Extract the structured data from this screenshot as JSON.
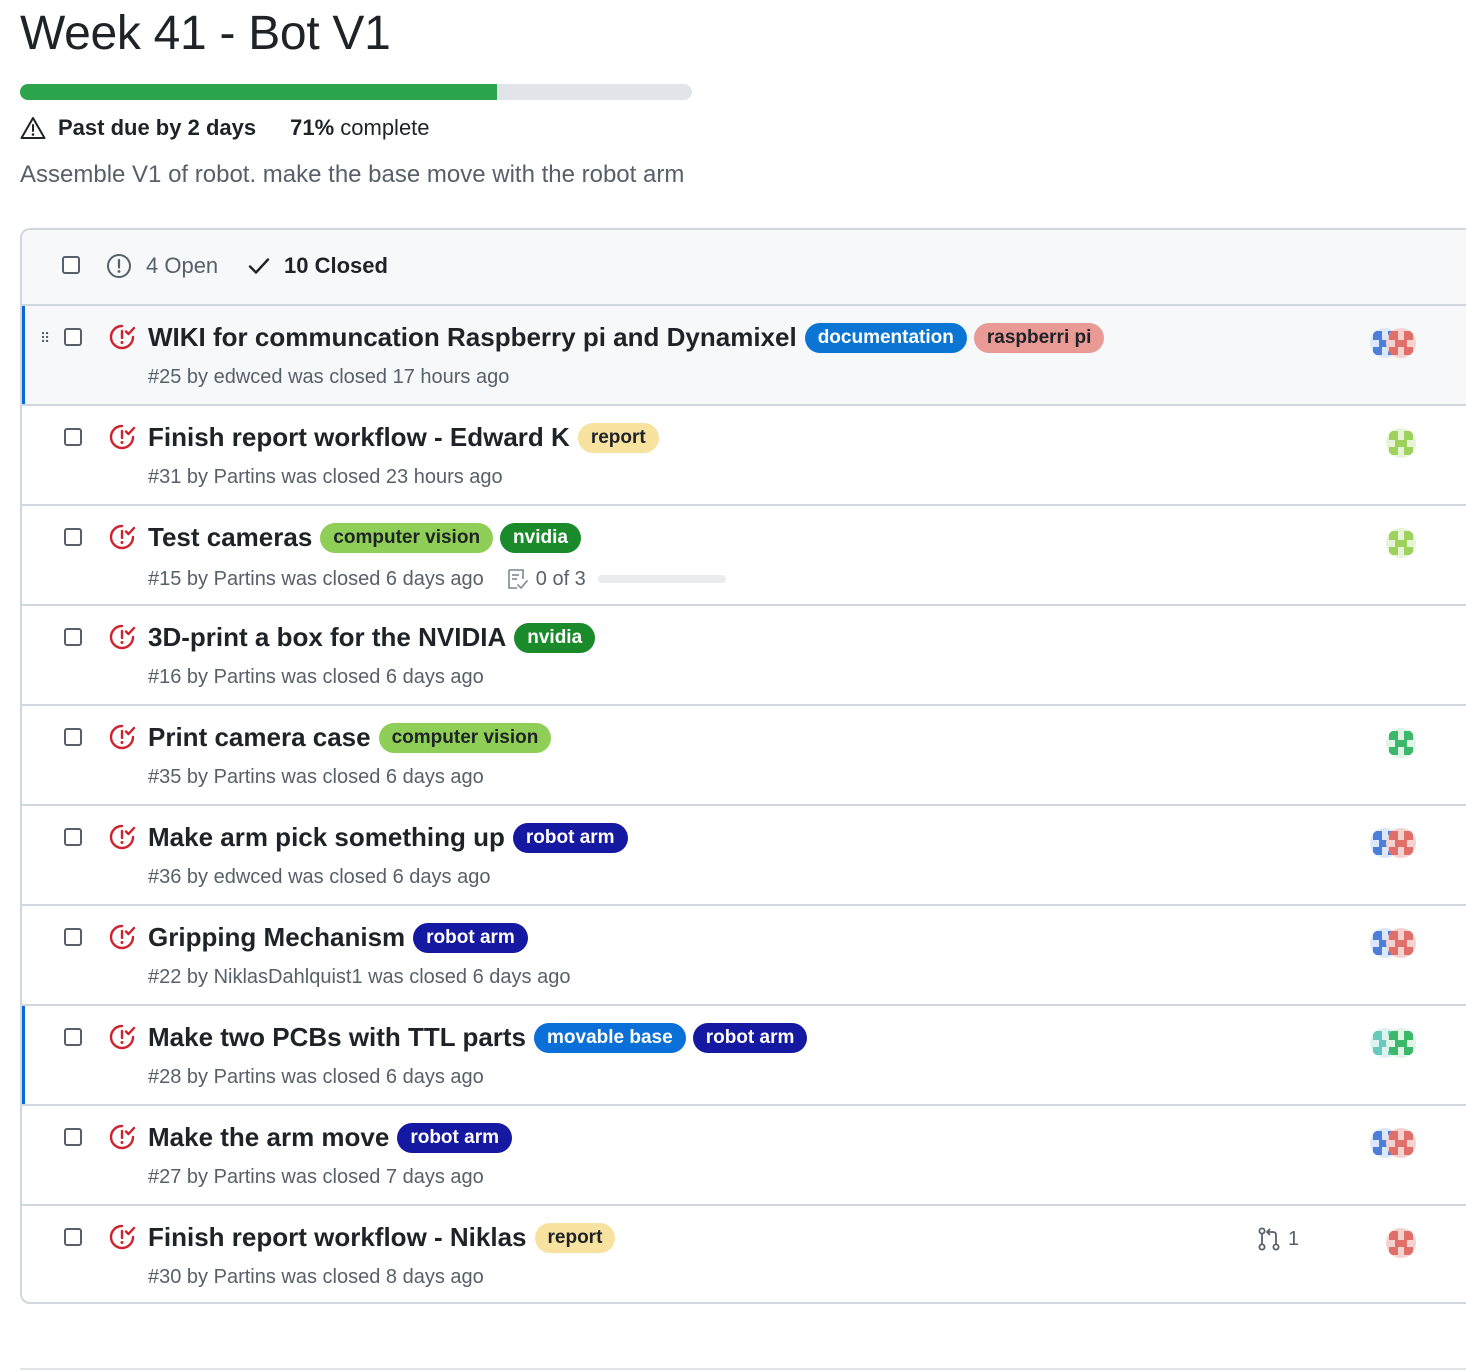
{
  "milestone": {
    "title": "Week 41 - Bot V1",
    "progress_fraction": 0.71,
    "due_text": "Past due by 2 days",
    "percent_value": "71%",
    "percent_suffix": " complete",
    "description": "Assemble V1 of robot. make the base move with the robot arm"
  },
  "filters": {
    "open_label": "4 Open",
    "closed_label": "10 Closed"
  },
  "issues": [
    {
      "title": "WIKI for communcation Raspberry pi and Dynamixel",
      "meta": "#25 by edwced was closed 17 hours ago",
      "labels": [
        {
          "name": "documentation",
          "bg": "#0b75d4",
          "fg": "#ffffff"
        },
        {
          "name": "raspberri pi",
          "bg": "#e99a95",
          "fg": "#1f2328"
        }
      ],
      "avatars": [
        "mixed-blue-red",
        "red"
      ]
    },
    {
      "title": "Finish report workflow - Edward K",
      "meta": "#31 by Partins was closed 23 hours ago",
      "labels": [
        {
          "name": "report",
          "bg": "#f8e2a0",
          "fg": "#1f2328"
        }
      ],
      "avatars": [
        "lime"
      ]
    },
    {
      "title": "Test cameras",
      "meta": "#15 by Partins was closed 6 days ago",
      "labels": [
        {
          "name": "computer vision",
          "bg": "#8fcf57",
          "fg": "#1f2328"
        },
        {
          "name": "nvidia",
          "bg": "#1a8a2a",
          "fg": "#ffffff"
        }
      ],
      "tasks": "0 of 3",
      "avatars": [
        "lime"
      ]
    },
    {
      "title": "3D-print a box for the NVIDIA",
      "meta": "#16 by Partins was closed 6 days ago",
      "labels": [
        {
          "name": "nvidia",
          "bg": "#1a8a2a",
          "fg": "#ffffff"
        }
      ],
      "avatars": []
    },
    {
      "title": "Print camera case",
      "meta": "#35 by Partins was closed 6 days ago",
      "labels": [
        {
          "name": "computer vision",
          "bg": "#8fcf57",
          "fg": "#1f2328"
        }
      ],
      "avatars": [
        "green"
      ]
    },
    {
      "title": "Make arm pick something up",
      "meta": "#36 by edwced was closed 6 days ago",
      "labels": [
        {
          "name": "robot arm",
          "bg": "#1518a0",
          "fg": "#ffffff"
        }
      ],
      "avatars": [
        "mixed-blue-red",
        "red"
      ]
    },
    {
      "title": "Gripping Mechanism",
      "meta": "#22 by NiklasDahlquist1 was closed 6 days ago",
      "labels": [
        {
          "name": "robot arm",
          "bg": "#1518a0",
          "fg": "#ffffff"
        }
      ],
      "avatars": [
        "mixed-blue-red",
        "red"
      ]
    },
    {
      "title": "Make two PCBs with TTL parts",
      "meta": "#28 by Partins was closed 6 days ago",
      "labels": [
        {
          "name": "movable base",
          "bg": "#0b6fd8",
          "fg": "#ffffff"
        },
        {
          "name": "robot arm",
          "bg": "#1518a0",
          "fg": "#ffffff"
        }
      ],
      "avatars": [
        "teal",
        "green"
      ]
    },
    {
      "title": "Make the arm move",
      "meta": "#27 by Partins was closed 7 days ago",
      "labels": [
        {
          "name": "robot arm",
          "bg": "#1518a0",
          "fg": "#ffffff"
        }
      ],
      "avatars": [
        "mixed-blue-red",
        "red"
      ]
    },
    {
      "title": "Finish report workflow - Niklas",
      "meta": "#30 by Partins was closed 8 days ago",
      "labels": [
        {
          "name": "report",
          "bg": "#f8e2a0",
          "fg": "#1f2328"
        }
      ],
      "linked_prs": "1",
      "avatars": [
        "red"
      ]
    }
  ],
  "colors": {
    "closed_icon": "#cf222e",
    "progress": "#2da44e",
    "active_marker": "#0969da"
  }
}
